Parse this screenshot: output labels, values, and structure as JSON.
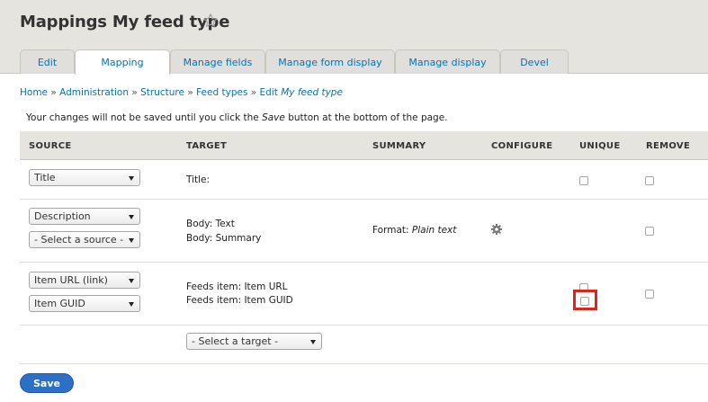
{
  "page": {
    "title": "Mappings My feed type"
  },
  "tabs": [
    {
      "label": "Edit"
    },
    {
      "label": "Mapping"
    },
    {
      "label": "Manage fields"
    },
    {
      "label": "Manage form display"
    },
    {
      "label": "Manage display"
    },
    {
      "label": "Devel"
    }
  ],
  "breadcrumb": {
    "items": [
      "Home",
      "Administration",
      "Structure",
      "Feed types",
      "Edit"
    ],
    "current": "My feed type",
    "separator": "»"
  },
  "notice": {
    "before": "Your changes will not be saved until you click the",
    "emph": "Save",
    "after": "button at the bottom of the page."
  },
  "table": {
    "headers": [
      "SOURCE",
      "TARGET",
      "SUMMARY",
      "CONFIGURE",
      "UNIQUE",
      "REMOVE"
    ],
    "rows": [
      {
        "sources": [
          "Title"
        ],
        "targets": [
          "Title:"
        ],
        "summary_label": "",
        "summary_value": "",
        "configurable": false,
        "unique_checkboxes": 1,
        "remove_checked": false
      },
      {
        "sources": [
          "Description",
          "- Select a source -"
        ],
        "targets": [
          "Body: Text",
          "Body: Summary"
        ],
        "summary_label": "Format:",
        "summary_value": "Plain text",
        "configurable": true,
        "unique_checkboxes": 0,
        "remove_checked": false
      },
      {
        "sources": [
          "Item URL (link)",
          "Item GUID"
        ],
        "targets": [
          "Feeds item: Item URL",
          "Feeds item: Item GUID"
        ],
        "summary_label": "",
        "summary_value": "",
        "configurable": false,
        "unique_checkboxes": 2,
        "remove_checked": false
      }
    ],
    "add_target_placeholder": "- Select a target -"
  },
  "actions": {
    "save_label": "Save"
  },
  "colors": {
    "link": "#0074bd",
    "header_bg": "#e6e4df",
    "primary_button": "#2b6fc6",
    "highlight": "#e2231a"
  },
  "icons": {
    "title_star": "star-outline-icon",
    "configure": "gear-icon"
  }
}
